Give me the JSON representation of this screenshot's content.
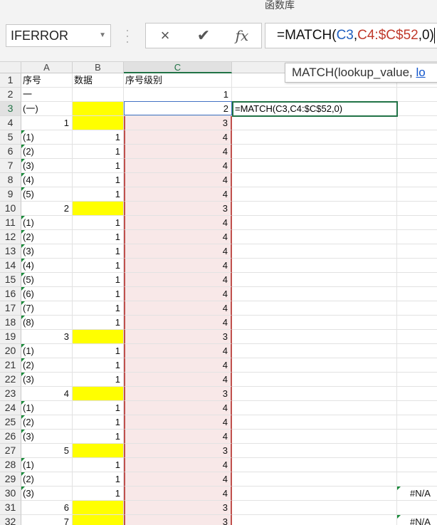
{
  "window": {
    "title": "函数库"
  },
  "formula_bar": {
    "name_box": "IFERROR",
    "cancel_icon": "×",
    "enter_icon": "✔",
    "fx_label": "fx",
    "formula_parts": [
      "=MATCH(",
      "C3",
      ",",
      "C4:$C$52",
      ",0)"
    ]
  },
  "tooltip": {
    "text": "MATCH(lookup_value, ",
    "link": "lo"
  },
  "columns": [
    "A",
    "B",
    "C"
  ],
  "header_row": {
    "a": "序号",
    "b": "数据",
    "c": "序号级别"
  },
  "editing_cell": {
    "text": "=MATCH(C3,C4:$C$52,0)"
  },
  "rows": [
    {
      "n": "1"
    },
    {
      "n": "2",
      "a": "一",
      "c": "1"
    },
    {
      "n": "3",
      "a": "(一)",
      "c": "2",
      "yb": true
    },
    {
      "n": "4",
      "a": "1",
      "b": "",
      "c": "3",
      "yb": true,
      "anum": true
    },
    {
      "n": "5",
      "a": "(1)",
      "b": "1",
      "c": "4",
      "tri": true
    },
    {
      "n": "6",
      "a": "(2)",
      "b": "1",
      "c": "4",
      "tri": true
    },
    {
      "n": "7",
      "a": "(3)",
      "b": "1",
      "c": "4",
      "tri": true
    },
    {
      "n": "8",
      "a": "(4)",
      "b": "1",
      "c": "4",
      "tri": true
    },
    {
      "n": "9",
      "a": "(5)",
      "b": "1",
      "c": "4",
      "tri": true
    },
    {
      "n": "10",
      "a": "2",
      "c": "3",
      "yb": true,
      "anum": true
    },
    {
      "n": "11",
      "a": "(1)",
      "b": "1",
      "c": "4",
      "tri": true
    },
    {
      "n": "12",
      "a": "(2)",
      "b": "1",
      "c": "4",
      "tri": true
    },
    {
      "n": "13",
      "a": "(3)",
      "b": "1",
      "c": "4",
      "tri": true
    },
    {
      "n": "14",
      "a": "(4)",
      "b": "1",
      "c": "4",
      "tri": true
    },
    {
      "n": "15",
      "a": "(5)",
      "b": "1",
      "c": "4",
      "tri": true
    },
    {
      "n": "16",
      "a": "(6)",
      "b": "1",
      "c": "4",
      "tri": true
    },
    {
      "n": "17",
      "a": "(7)",
      "b": "1",
      "c": "4",
      "tri": true
    },
    {
      "n": "18",
      "a": "(8)",
      "b": "1",
      "c": "4",
      "tri": true
    },
    {
      "n": "19",
      "a": "3",
      "c": "3",
      "yb": true,
      "anum": true
    },
    {
      "n": "20",
      "a": "(1)",
      "b": "1",
      "c": "4",
      "tri": true
    },
    {
      "n": "21",
      "a": "(2)",
      "b": "1",
      "c": "4",
      "tri": true
    },
    {
      "n": "22",
      "a": "(3)",
      "b": "1",
      "c": "4",
      "tri": true
    },
    {
      "n": "23",
      "a": "4",
      "c": "3",
      "yb": true,
      "anum": true
    },
    {
      "n": "24",
      "a": "(1)",
      "b": "1",
      "c": "4",
      "tri": true
    },
    {
      "n": "25",
      "a": "(2)",
      "b": "1",
      "c": "4",
      "tri": true
    },
    {
      "n": "26",
      "a": "(3)",
      "b": "1",
      "c": "4",
      "tri": true
    },
    {
      "n": "27",
      "a": "5",
      "c": "3",
      "yb": true,
      "anum": true
    },
    {
      "n": "28",
      "a": "(1)",
      "b": "1",
      "c": "4",
      "tri": true
    },
    {
      "n": "29",
      "a": "(2)",
      "b": "1",
      "c": "4",
      "tri": true
    },
    {
      "n": "30",
      "a": "(3)",
      "b": "1",
      "c": "4",
      "tri": true,
      "err": "#N/A"
    },
    {
      "n": "31",
      "a": "6",
      "c": "3",
      "yb": true,
      "anum": true
    },
    {
      "n": "32",
      "a": "7",
      "c": "3",
      "yb": true,
      "anum": true,
      "err": "#N/A"
    }
  ],
  "colors": {
    "header_bg": "#f0f0f0",
    "highlight_yellow": "#ffff00",
    "range_fill": "#f8e8e8",
    "range_border": "#c0504d",
    "ref_blue": "#1f5fbf",
    "ref_red": "#c0392b",
    "active_green": "#217346"
  }
}
